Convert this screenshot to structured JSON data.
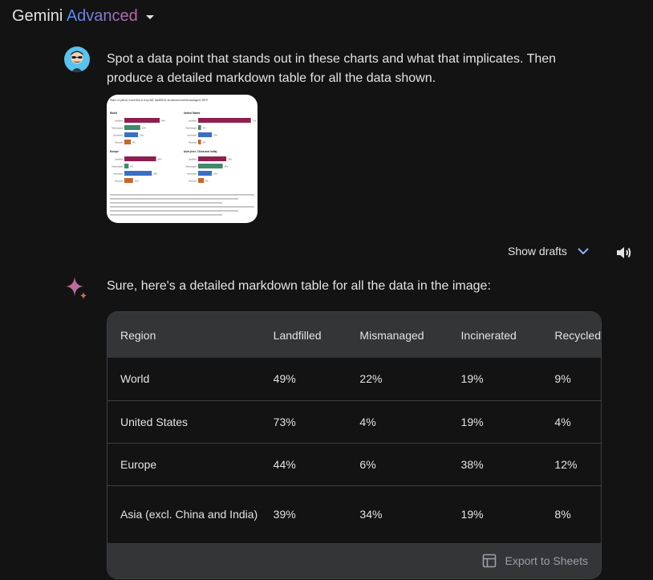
{
  "header": {
    "brand": "Gemini",
    "tier": "Advanced"
  },
  "user": {
    "prompt": "Spot a data point that stands out in these charts and what that implicates. Then produce a detailed markdown table for all the data shown."
  },
  "attachment": {
    "title": "Share of plastic waste that is recycled, landfilled, incinerated and mismanaged, 2019",
    "panels": [
      {
        "name": "World",
        "values": [
          49,
          22,
          19,
          9
        ]
      },
      {
        "name": "United States",
        "values": [
          73,
          4,
          19,
          4
        ]
      },
      {
        "name": "Europe",
        "values": [
          44,
          6,
          38,
          12
        ]
      },
      {
        "name": "Asia (excl. China and India)",
        "values": [
          39,
          34,
          19,
          8
        ]
      }
    ],
    "bar_labels": [
      "Landfilled",
      "Mismanaged",
      "Incinerated",
      "Recycled"
    ]
  },
  "controls": {
    "show_drafts": "Show drafts"
  },
  "response": {
    "intro": "Sure, here's a detailed markdown table for all the data in the image:",
    "table": {
      "headers": [
        "Region",
        "Landfilled",
        "Mismanaged",
        "Incinerated",
        "Recycled"
      ],
      "rows": [
        [
          "World",
          "49%",
          "22%",
          "19%",
          "9%"
        ],
        [
          "United States",
          "73%",
          "4%",
          "19%",
          "4%"
        ],
        [
          "Europe",
          "44%",
          "6%",
          "38%",
          "12%"
        ],
        [
          "Asia (excl. China and India)",
          "39%",
          "34%",
          "19%",
          "8%"
        ]
      ]
    },
    "export_label": "Export to Sheets"
  },
  "colors": {
    "landfilled": "#8e2050",
    "mismanaged": "#3e8a6a",
    "incinerated": "#3a6fc4",
    "recycled": "#c9662d"
  }
}
